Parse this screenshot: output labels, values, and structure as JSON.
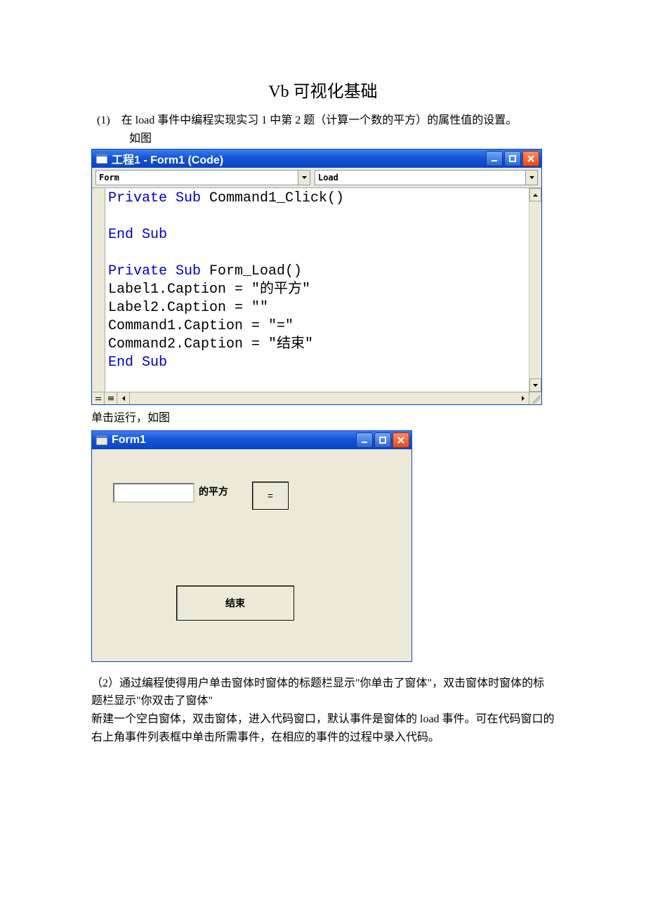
{
  "doc": {
    "title": "Vb 可视化基础",
    "item1_label": "(1)",
    "item1_text": "在 load 事件中编程实现实习 1 中第 2 题（计算一个数的平方）的属性值的设置。",
    "item1_line2": "如图",
    "between": "单击运行，如图",
    "item2_1": "（2）通过编程使得用户单击窗体时窗体的标题栏显示\"你单击了窗体\"，双击窗体时窗体的标题栏显示\"你双击了窗体\"",
    "item2_2": "新建一个空白窗体，双击窗体，进入代码窗口，默认事件是窗体的 load 事件。可在代码窗口的右上角事件列表框中单击所需事件，在相应的事件的过程中录入代码。"
  },
  "codewin": {
    "title": "工程1 - Form1 (Code)",
    "combo_object": "Form",
    "combo_event": "Load",
    "code": {
      "l1_a": "Private Sub ",
      "l1_b": "Command1_Click()",
      "l2": "",
      "l3": "End Sub",
      "l4": "",
      "l5_a": "Private Sub ",
      "l5_b": "Form_Load()",
      "l6": "Label1.Caption = \"的平方\"",
      "l7": "Label2.Caption = \"\"",
      "l8": "Command1.Caption = \"=\"",
      "l9": "Command2.Caption = \"结束\"",
      "l10": "End Sub"
    }
  },
  "formwin": {
    "title": "Form1",
    "label1": "的平方",
    "btn_eq": "=",
    "btn_end": "结束"
  }
}
